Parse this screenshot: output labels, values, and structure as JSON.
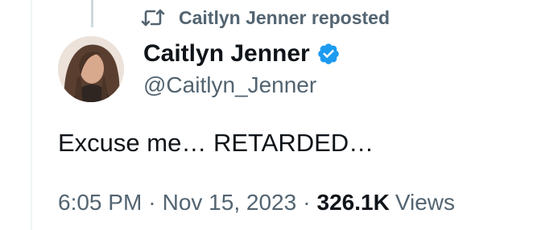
{
  "repost": {
    "icon": "repost-icon",
    "text": "Caitlyn Jenner reposted"
  },
  "author": {
    "avatar_icon": "avatar",
    "display_name": "Caitlyn Jenner",
    "verified_icon": "verified-badge-icon",
    "handle": "@Caitlyn_Jenner"
  },
  "tweet": {
    "text": "Excuse me… RETARDED…"
  },
  "meta": {
    "time": "6:05 PM",
    "separator": "·",
    "date": "Nov 15, 2023",
    "views_count": "326.1K",
    "views_label": "Views"
  },
  "colors": {
    "primary_text": "#0f1419",
    "secondary_text": "#536471",
    "verified_blue": "#1d9bf0",
    "thread_line": "#cfd9de"
  }
}
